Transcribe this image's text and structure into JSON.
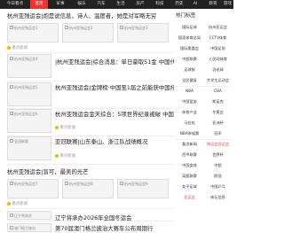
{
  "nav": {
    "items": [
      {
        "label": "今日看点",
        "active": false
      },
      {
        "label": "首页",
        "active": true
      },
      {
        "label": "军事",
        "active": false
      },
      {
        "label": "娱乐",
        "active": false
      },
      {
        "label": "汽车",
        "active": false
      },
      {
        "label": "生活",
        "active": false
      },
      {
        "label": "房产",
        "active": false
      },
      {
        "label": "科技",
        "active": false
      },
      {
        "label": "历史",
        "active": false
      },
      {
        "label": "AI",
        "active": false
      },
      {
        "label": "教育",
        "active": false
      },
      {
        "label": "游戏",
        "active": false
      }
    ]
  },
  "feed": {
    "articles": [
      {
        "title": "杭州亚残运会|炮是说信息，诗人、温度者，她是对军略无穷",
        "thumbs": [
          "杭州亚残运会1",
          "杭州亚残运会2",
          "杭州亚残运会3"
        ],
        "meta": "看点新闻"
      },
      {
        "title": "|杭州亚残运会|综合消息：单日豪取51金 中国代表团118金“断层”领先",
        "thumbs": [
          "杭州亚残运会4"
        ],
        "meta": ""
      },
      {
        "title": "杭州亚残运会|金牌榜·中国至1届之前能获中国排",
        "thumbs": [
          "杭州亚残运会5"
        ],
        "meta": ""
      },
      {
        "title": "杭州亚残运会金天综合：5项世界纪录被破 中国队夺51枚金牌",
        "thumbs": [
          "杭州亚残运会6"
        ],
        "meta": "看点新闻"
      },
      {
        "title": "亚冠联赛|山东泰山、浙江队战绩概况",
        "thumbs": [
          "亚冠联赛"
        ],
        "meta": "看点新闻"
      },
      {
        "title": "杭州亚残运会|盲可，最美的光芒",
        "thumbs": [
          "杭州亚残运会7",
          "杭州亚残运会8",
          "杭州亚残运会9"
        ],
        "meta": "看点新闻"
      },
      {
        "title": "辽宁将承办2026年全国冬运会",
        "thumbs": [
          "辽宁将承办"
        ],
        "meta": ""
      },
      {
        "title": "第70届澳门格兰披治大赛车公布周期行",
        "thumbs": [
          "澳门格兰披治"
        ],
        "meta": ""
      }
    ]
  },
  "sidebar": {
    "title": "热门标签",
    "rows": [
      [
        "国际足球",
        "杭州亚运会"
      ],
      [
        "国家体育总局",
        "CCTV体育"
      ],
      [
        "国际奥委会",
        "中国足协"
      ],
      [
        "中超联赛",
        "人民网体育"
      ],
      [
        "足球报",
        "羽毛球"
      ],
      [
        "全民健身",
        "大学生运动会"
      ],
      [
        "NBA",
        "CBA"
      ],
      [
        "中国篮协",
        "斯诺克"
      ],
      [
        "体育产业",
        "冬奥会"
      ],
      [
        "马拉松",
        "亚洲杯"
      ],
      [
        "NBA季候赛",
        "冠军"
      ],
      [
        "看点新闻",
        "残运会亚运会"
      ],
      [
        "西甲联赛",
        "世界杯"
      ],
      [
        "中国女排",
        "中超"
      ],
      [
        "英超联赛",
        "欧冠"
      ],
      [
        "女子足球",
        "中国乒乓"
      ],
      [
        "亚运会",
        "体坛信息"
      ]
    ],
    "red_index": [
      [
        11,
        1
      ],
      [
        16,
        0
      ]
    ]
  }
}
